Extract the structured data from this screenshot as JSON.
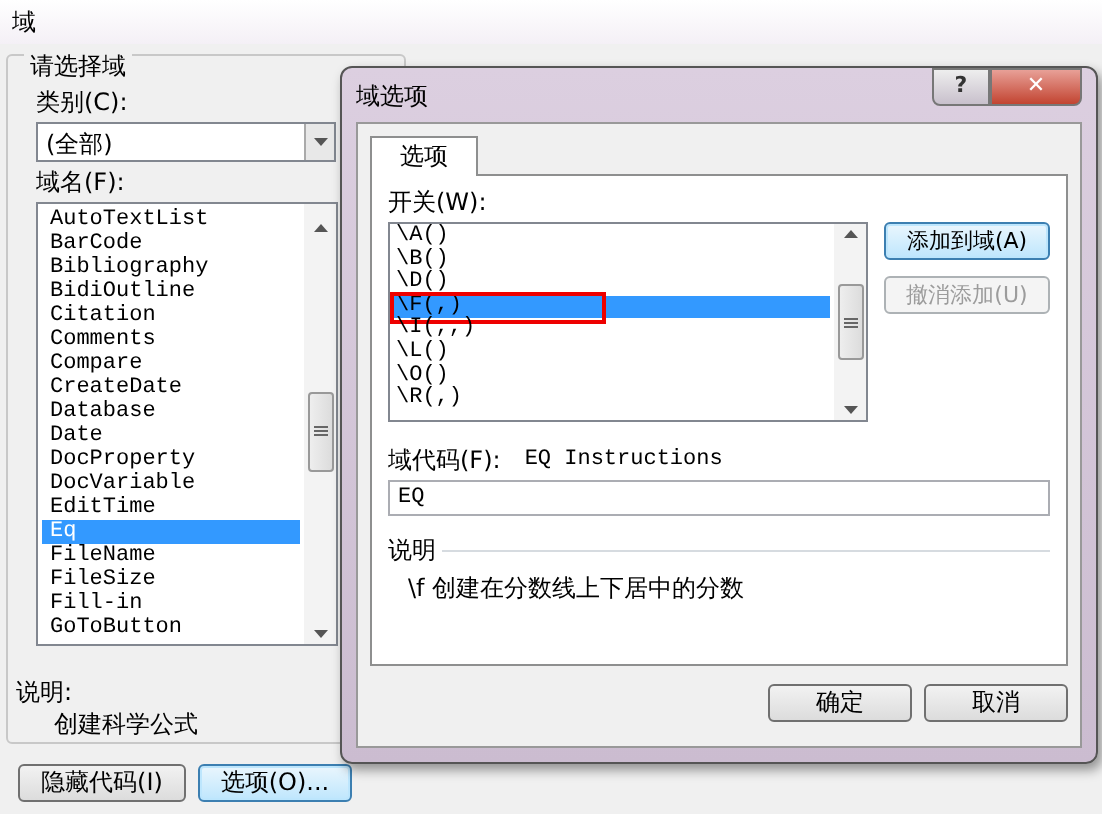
{
  "window": {
    "title": "域"
  },
  "field_group": {
    "title": "请选择域",
    "category_label": "类别(C):",
    "category_value": "(全部)",
    "names_label": "域名(F):",
    "field_names": [
      {
        "label": "AutoTextList",
        "selected": false
      },
      {
        "label": "BarCode",
        "selected": false
      },
      {
        "label": "Bibliography",
        "selected": false
      },
      {
        "label": "BidiOutline",
        "selected": false
      },
      {
        "label": "Citation",
        "selected": false
      },
      {
        "label": "Comments",
        "selected": false
      },
      {
        "label": "Compare",
        "selected": false
      },
      {
        "label": "CreateDate",
        "selected": false
      },
      {
        "label": "Database",
        "selected": false
      },
      {
        "label": "Date",
        "selected": false
      },
      {
        "label": "DocProperty",
        "selected": false
      },
      {
        "label": "DocVariable",
        "selected": false
      },
      {
        "label": "EditTime",
        "selected": false
      },
      {
        "label": "Eq",
        "selected": true
      },
      {
        "label": "FileName",
        "selected": false
      },
      {
        "label": "FileSize",
        "selected": false
      },
      {
        "label": "Fill-in",
        "selected": false
      },
      {
        "label": "GoToButton",
        "selected": false
      }
    ]
  },
  "description": {
    "label": "说明:",
    "text": "创建科学公式"
  },
  "buttons": [
    {
      "label": "隐藏代码(I)",
      "focused": false
    },
    {
      "label": "选项(O)...",
      "focused": true
    }
  ],
  "options_dialog": {
    "title": "域选项",
    "help": "?",
    "close": "✕",
    "tabs": [
      {
        "label": "选项",
        "selected": true
      }
    ],
    "switches_label": "开关(W):",
    "switches": [
      {
        "label": "\\A()",
        "selected": false,
        "annotated": false
      },
      {
        "label": "\\B()",
        "selected": false,
        "annotated": false
      },
      {
        "label": "\\D()",
        "selected": false,
        "annotated": false
      },
      {
        "label": "\\F(,)",
        "selected": true,
        "annotated": true
      },
      {
        "label": "\\I(,,)",
        "selected": false,
        "annotated": false
      },
      {
        "label": "\\L()",
        "selected": false,
        "annotated": false
      },
      {
        "label": "\\O()",
        "selected": false,
        "annotated": false
      },
      {
        "label": "\\R(,)",
        "selected": false,
        "annotated": false
      }
    ],
    "side_buttons": [
      {
        "label": "添加到域(A)",
        "disabled": false
      },
      {
        "label": "撤消添加(U)",
        "disabled": true
      }
    ],
    "code_label": "域代码(F):",
    "code_hint": "EQ Instructions",
    "code_value": "EQ",
    "description_label": "说明",
    "description_text": "\\f 创建在分数线上下居中的分数",
    "buttons": [
      {
        "label": "确定"
      },
      {
        "label": "取消"
      }
    ]
  }
}
